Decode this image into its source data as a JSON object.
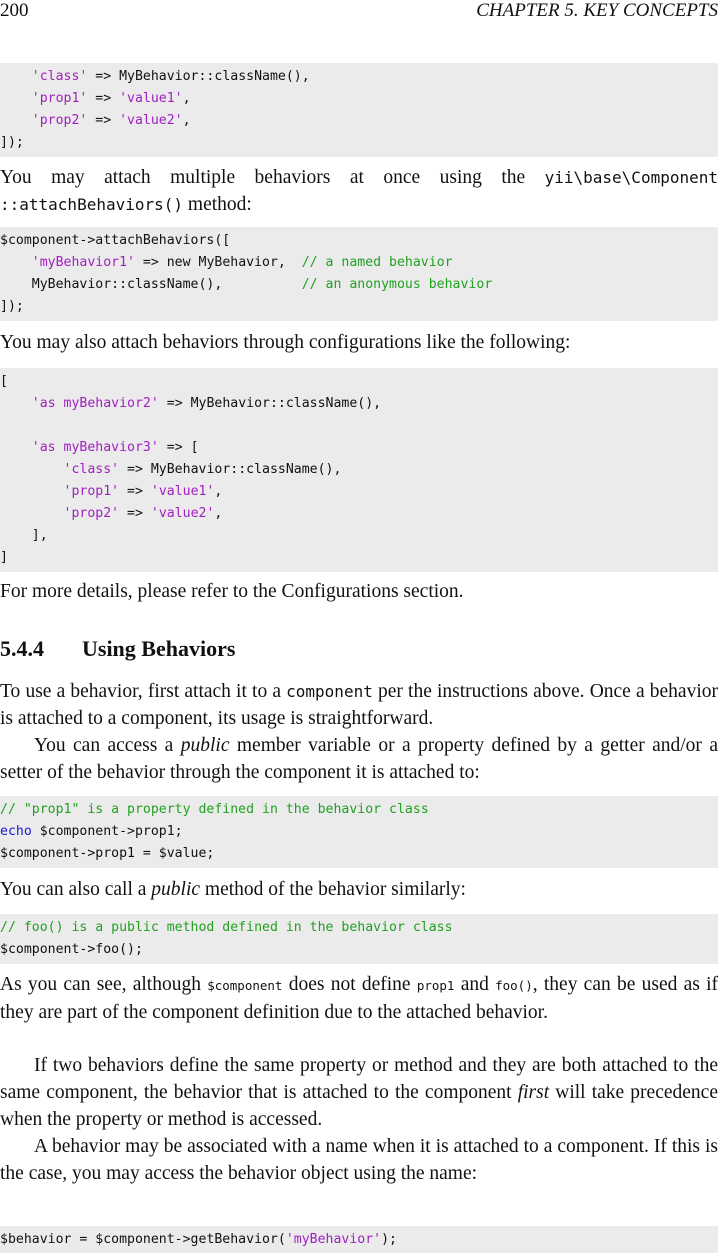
{
  "header": {
    "page_number": "200",
    "chapter": "CHAPTER 5.  KEY CONCEPTS"
  },
  "code1": [
    [
      [
        "    ",
        ""
      ],
      [
        "'class'",
        "s"
      ],
      [
        " => MyBehavior::className(),",
        ""
      ]
    ],
    [
      [
        "    ",
        ""
      ],
      [
        "'prop1'",
        "s"
      ],
      [
        " => ",
        ""
      ],
      [
        "'value1'",
        "s"
      ],
      [
        ",",
        ""
      ]
    ],
    [
      [
        "    ",
        ""
      ],
      [
        "'prop2'",
        "s"
      ],
      [
        " => ",
        ""
      ],
      [
        "'value2'",
        "s"
      ],
      [
        ",",
        ""
      ]
    ],
    [
      [
        "]);",
        ""
      ]
    ]
  ],
  "para1": [
    [
      "You may attach multiple behaviors at once using the ",
      ""
    ],
    [
      "yii\\base\\Component ::attachBehaviors()",
      "tt"
    ],
    [
      " method:",
      ""
    ]
  ],
  "code2": [
    [
      [
        "$component->attachBehaviors([",
        ""
      ]
    ],
    [
      [
        "    ",
        ""
      ],
      [
        "'myBehavior1'",
        "s"
      ],
      [
        " => new MyBehavior,  ",
        ""
      ],
      [
        "// a named behavior",
        "c"
      ]
    ],
    [
      [
        "    MyBehavior::className(),          ",
        ""
      ],
      [
        "// an anonymous behavior",
        "c"
      ]
    ],
    [
      [
        "]);",
        ""
      ]
    ]
  ],
  "para2": [
    [
      "You may also attach behaviors through configurations like the following:",
      ""
    ]
  ],
  "code3": [
    [
      [
        "[",
        ""
      ]
    ],
    [
      [
        "    ",
        ""
      ],
      [
        "'as myBehavior2'",
        "s"
      ],
      [
        " => MyBehavior::className(),",
        ""
      ]
    ],
    [
      [
        "",
        ""
      ]
    ],
    [
      [
        "    ",
        ""
      ],
      [
        "'as myBehavior3'",
        "s"
      ],
      [
        " => [",
        ""
      ]
    ],
    [
      [
        "        ",
        ""
      ],
      [
        "'class'",
        "s"
      ],
      [
        " => MyBehavior::className(),",
        ""
      ]
    ],
    [
      [
        "        ",
        ""
      ],
      [
        "'prop1'",
        "s"
      ],
      [
        " => ",
        ""
      ],
      [
        "'value1'",
        "s"
      ],
      [
        ",",
        ""
      ]
    ],
    [
      [
        "        ",
        ""
      ],
      [
        "'prop2'",
        "s"
      ],
      [
        " => ",
        ""
      ],
      [
        "'value2'",
        "s"
      ],
      [
        ",",
        ""
      ]
    ],
    [
      [
        "    ],",
        ""
      ]
    ],
    [
      [
        "]",
        ""
      ]
    ]
  ],
  "para3": [
    [
      "For more details, please refer to the Configurations section.",
      ""
    ]
  ],
  "section": {
    "number": "5.4.4",
    "title": "Using Behaviors"
  },
  "para4": [
    [
      "To use a behavior, first attach it to a ",
      ""
    ],
    [
      "component",
      "tt"
    ],
    [
      " per the instructions above. Once a behavior is attached to a component, its usage is straightforward.",
      ""
    ]
  ],
  "para5": [
    [
      "You can access a ",
      ""
    ],
    [
      "public",
      "em"
    ],
    [
      " member variable or a property defined by a getter and/or a setter of the behavior through the component it is attached to:",
      ""
    ]
  ],
  "code4": [
    [
      [
        "// \"prop1\" is a property defined in the behavior class",
        "c"
      ]
    ],
    [
      [
        "echo",
        "k"
      ],
      [
        " $component->prop1;",
        ""
      ]
    ],
    [
      [
        "$component->prop1 = $value;",
        ""
      ]
    ]
  ],
  "para6": [
    [
      "You can also call a ",
      ""
    ],
    [
      "public",
      "em"
    ],
    [
      " method of the behavior similarly:",
      ""
    ]
  ],
  "code5": [
    [
      [
        "// foo() is a public method defined in the behavior class",
        "c"
      ]
    ],
    [
      [
        "$component->foo();",
        ""
      ]
    ]
  ],
  "para7": [
    [
      "As you can see, although ",
      ""
    ],
    [
      "$component",
      "tts"
    ],
    [
      " does not define ",
      ""
    ],
    [
      "prop1",
      "tts"
    ],
    [
      " and ",
      ""
    ],
    [
      "foo()",
      "tts"
    ],
    [
      ", they can be used as if they are part of the component definition due to the attached behavior.",
      ""
    ]
  ],
  "para8": [
    [
      "If two behaviors define the same property or method and they are both attached to the same component, the behavior that is attached to the component ",
      ""
    ],
    [
      "first",
      "em"
    ],
    [
      " will take precedence when the property or method is accessed.",
      ""
    ]
  ],
  "para9": [
    [
      "A behavior may be associated with a name when it is attached to a component. If this is the case, you may access the behavior object using the name:",
      ""
    ]
  ],
  "code6": [
    [
      [
        "$behavior = $component->getBehavior(",
        ""
      ],
      [
        "'myBehavior'",
        "s"
      ],
      [
        ");",
        ""
      ]
    ]
  ]
}
